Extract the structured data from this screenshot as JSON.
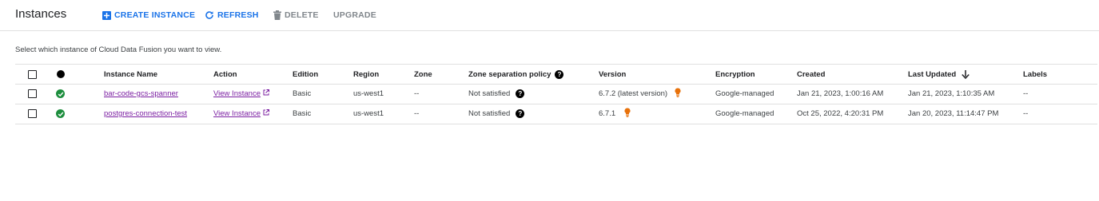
{
  "header": {
    "title": "Instances",
    "create_label": "CREATE INSTANCE",
    "refresh_label": "REFRESH",
    "delete_label": "DELETE",
    "upgrade_label": "UPGRADE"
  },
  "subtitle": "Select which instance of Cloud Data Fusion you want to view.",
  "table": {
    "columns": {
      "name": "Instance Name",
      "action": "Action",
      "edition": "Edition",
      "region": "Region",
      "zone": "Zone",
      "zone_policy": "Zone separation policy",
      "version": "Version",
      "encryption": "Encryption",
      "created": "Created",
      "updated": "Last Updated",
      "labels": "Labels"
    },
    "rows": [
      {
        "name": "bar-code-gcs-spanner",
        "action": "View Instance",
        "edition": "Basic",
        "region": "us-west1",
        "zone": "--",
        "zone_policy": "Not satisfied",
        "version": "6.7.2 (latest version)",
        "encryption": "Google-managed",
        "created": "Jan 21, 2023, 1:00:16 AM",
        "updated": "Jan 21, 2023, 1:10:35 AM",
        "labels": "--"
      },
      {
        "name": "postgres-connection-test",
        "action": "View Instance",
        "edition": "Basic",
        "region": "us-west1",
        "zone": "--",
        "zone_policy": "Not satisfied",
        "version": "6.7.1",
        "encryption": "Google-managed",
        "created": "Oct 25, 2022, 4:20:31 PM",
        "updated": "Jan 20, 2023, 11:14:47 PM",
        "labels": "--"
      }
    ]
  },
  "icons": {
    "create": "add-box-icon",
    "refresh": "refresh-icon",
    "delete": "trash-icon",
    "sort": "arrow-down-icon",
    "help": "help-circle-icon",
    "status": "check-circle-icon",
    "external": "open-in-new-icon",
    "recommendation": "lightbulb-icon"
  },
  "colors": {
    "accent": "#1a73e8",
    "link": "#7b1fa2",
    "status_ok": "#1e8e3e",
    "recommendation": "#e8710a"
  }
}
